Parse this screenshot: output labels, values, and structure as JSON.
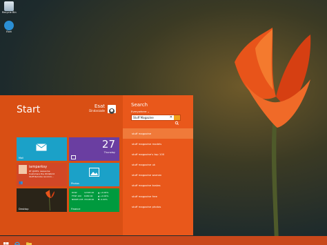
{
  "desktop": {
    "icons": [
      {
        "label": "Recycle Bin",
        "icon": "recycle-bin-icon"
      },
      {
        "label": "Esat",
        "icon": "user-folder-icon"
      }
    ]
  },
  "start": {
    "title": "Start",
    "user": {
      "name": "Esat",
      "subtitle": "Dindarzade"
    },
    "tiles": {
      "mail": {
        "label": "Mail",
        "icon": "mail-icon",
        "color": "#1ba1c8"
      },
      "calendar": {
        "day": "27",
        "weekday": "Thursday",
        "color": "#6a3ea1"
      },
      "people": {
        "name": "iamparksy",
        "lines": [
          "RT @DHS: Awesome",
          "Customers the WinWorld",
          "Stuff Remote recomm..."
        ],
        "color": "#d24726"
      },
      "photos": {
        "label": "Photos",
        "icon": "photos-icon",
        "color": "#1ba1c8"
      },
      "desktop": {
        "label": "Desktop"
      },
      "finance": {
        "label": "Finance",
        "color": "#009a3e",
        "quotes": [
          [
            "DOW",
            "12345 00",
            "▲ +0.00%"
          ],
          [
            "FTSE 100",
            "6480 00",
            "▲ +0.00%"
          ],
          [
            "NIKKEI 225",
            "15108 00",
            "▼ -0.00%"
          ]
        ]
      }
    }
  },
  "search": {
    "title": "Search",
    "scope": "Everywhere",
    "query": "Stuff Magazine",
    "results": [
      "stuff magazine",
      "stuff magazine models",
      "stuff magazine's top 100",
      "stuff magazine uk",
      "stuff magazine women",
      "stuff magazine kostas",
      "stuff magazine free",
      "stuff magazine photos"
    ]
  },
  "colors": {
    "start_bg": "#d94f14",
    "search_bg": "#e9581b",
    "selected": "#f07a3a",
    "taskbar": "#c9481b"
  }
}
